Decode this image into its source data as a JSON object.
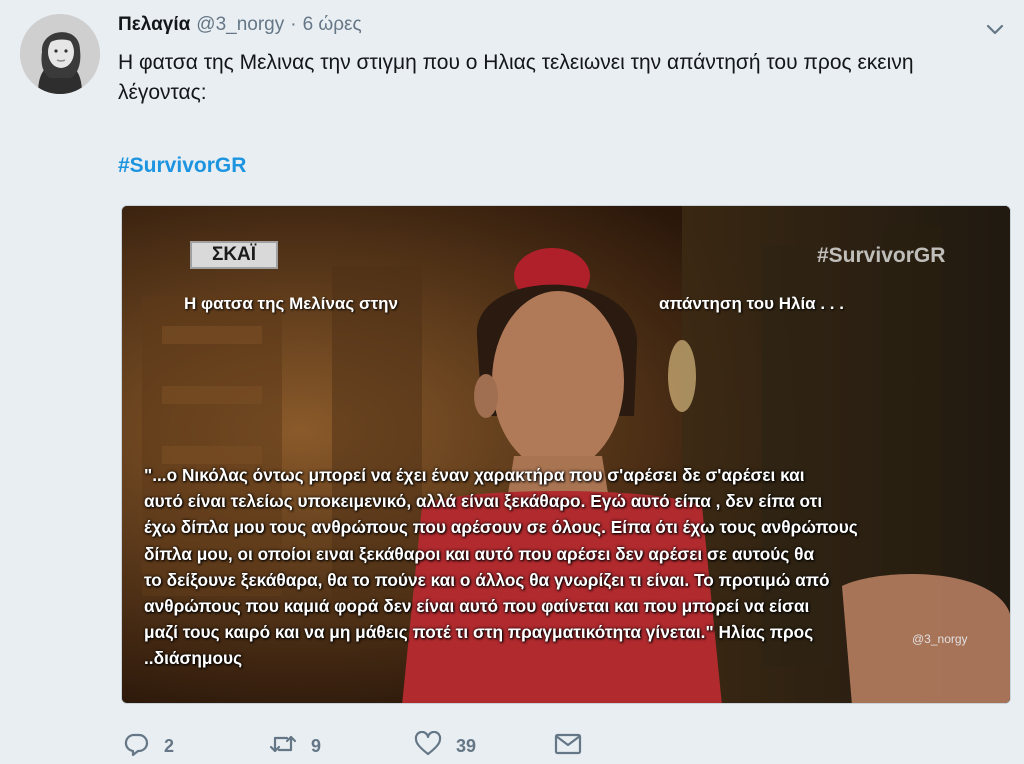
{
  "author": {
    "name": "Πελαγία",
    "handle": "@3_norgy",
    "separator": "·",
    "time": "6 ώρες"
  },
  "tweet": {
    "text": "Η φατσα της Μελινας την στιγμη που ο Ηλιας τελειωνει την απάντησή του προς εκεινη λέγοντας:",
    "hashtag": "#SurvivorGR"
  },
  "media": {
    "channel_logo": "ΣΚΑΪ",
    "watermark": "#SurvivorGR",
    "caption_left": "Η φατσα της Μελίνας στην",
    "caption_right": "απάντηση του Ηλία . . .",
    "credit": "@3_norgy",
    "quote": "\"...ο Νικόλας όντως μπορεί να έχει έναν χαρακτήρα που σ'αρέσει δε σ'αρέσει και\nαυτό είναι τελείως υποκειμενικό, αλλά είναι ξεκάθαρο. Εγώ αυτό είπα , δεν είπα οτι\nέχω δίπλα μου τους ανθρώπους που αρέσουν σε όλους. Είπα ότι έχω τους ανθρώπους\nδίπλα μου, οι οποίοι ειναι ξεκάθαροι και αυτό που αρέσει δεν αρέσει σε αυτούς θα\nτο δείξουνε ξεκάθαρα, θα το πούνε και ο άλλος θα γνωρίζει τι είναι. Το προτιμώ από\nανθρώπους που καμιά φορά δεν είναι αυτό που φαίνεται και που μπορεί να είσαι\nμαζί τους καιρό και να μη μάθεις ποτέ τι στη πραγματικότητα γίνεται.\"  Ηλίας προς\n..διάσημους"
  },
  "actions": {
    "reply_count": "2",
    "retweet_count": "9",
    "like_count": "39"
  },
  "colors": {
    "background": "#e9eef2",
    "link": "#1c94e0",
    "muted": "#657786"
  },
  "icons": [
    "caret-down-icon",
    "reply-icon",
    "retweet-icon",
    "like-icon",
    "message-icon"
  ]
}
